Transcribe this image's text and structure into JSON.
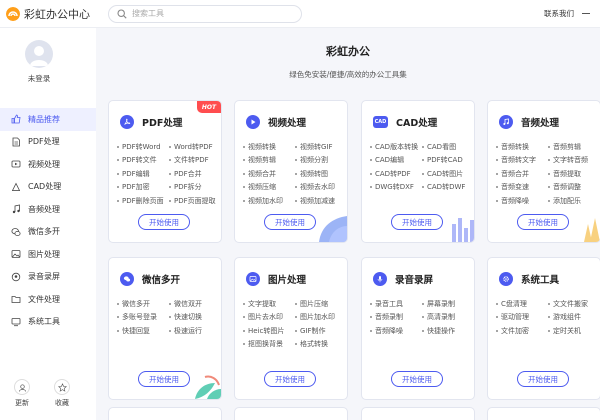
{
  "app": {
    "title": "彩虹办公中心",
    "contact": "联系我们"
  },
  "search": {
    "placeholder": "搜索工具"
  },
  "user": {
    "login": "未登录"
  },
  "sidebar": {
    "items": [
      {
        "label": "精品推荐",
        "icon": "thumbs-up-icon",
        "active": true
      },
      {
        "label": "PDF处理",
        "icon": "pdf-file-icon"
      },
      {
        "label": "视频处理",
        "icon": "video-icon"
      },
      {
        "label": "CAD处理",
        "icon": "cad-icon"
      },
      {
        "label": "音频处理",
        "icon": "music-icon"
      },
      {
        "label": "微信多开",
        "icon": "wechat-icon"
      },
      {
        "label": "图片处理",
        "icon": "image-icon"
      },
      {
        "label": "录音录屏",
        "icon": "record-icon"
      },
      {
        "label": "文件处理",
        "icon": "folder-icon"
      },
      {
        "label": "系统工具",
        "icon": "system-icon"
      }
    ],
    "bottom": [
      {
        "label": "更新",
        "icon": "update-icon"
      },
      {
        "label": "收藏",
        "icon": "star-icon"
      }
    ]
  },
  "main": {
    "title": "彩虹办公",
    "subtitle": "绿色免安装/便捷/高效的办公工具集",
    "start_label": "开始使用",
    "hot_badge": "HOT",
    "cards": [
      {
        "title": "PDF处理",
        "icon": "pdf-icon",
        "hot": true,
        "features": [
          "PDF转Word",
          "Word转PDF",
          "PDF转文件",
          "文件转PDF",
          "PDF编辑",
          "PDF合并",
          "PDF加密",
          "PDF拆分",
          "PDF删除页面",
          "PDF页面提取"
        ]
      },
      {
        "title": "视频处理",
        "icon": "video-play-icon",
        "features": [
          "视频转换",
          "视频转GIF",
          "视频剪辑",
          "视频分割",
          "视频合并",
          "视频转图",
          "视频压缩",
          "视频去水印",
          "视频加水印",
          "视频加减速"
        ]
      },
      {
        "title": "CAD处理",
        "icon": "cad-icon",
        "features": [
          "CAD版本转换",
          "CAD看图",
          "CAD编辑",
          "PDF转CAD",
          "CAD转PDF",
          "CAD转图片",
          "DWG转DXF",
          "CAD转DWF"
        ]
      },
      {
        "title": "音频处理",
        "icon": "music-note-icon",
        "features": [
          "音频转换",
          "音频剪辑",
          "音频转文字",
          "文字转音频",
          "音频合并",
          "音频提取",
          "音频变速",
          "音频调整",
          "音频降噪",
          "添加配乐"
        ]
      },
      {
        "title": "微信多开",
        "icon": "wechat-icon",
        "features": [
          "微信多开",
          "微信双开",
          "多账号登录",
          "快速切换",
          "快捷回复",
          "极速运行"
        ]
      },
      {
        "title": "图片处理",
        "icon": "image-icon",
        "features": [
          "文字提取",
          "图片压缩",
          "图片去水印",
          "图片加水印",
          "Heic转图片",
          "GIF制作",
          "抠图换背景",
          "格式转换"
        ]
      },
      {
        "title": "录音录屏",
        "icon": "microphone-icon",
        "features": [
          "录音工具",
          "屏幕录制",
          "音频录制",
          "高清录制",
          "音频降噪",
          "快捷操作"
        ]
      },
      {
        "title": "系统工具",
        "icon": "gear-icon",
        "features": [
          "C盘清理",
          "文文件搬家",
          "驱动管理",
          "游戏组件",
          "文件加密",
          "定时关机"
        ]
      }
    ]
  },
  "colors": {
    "accent": "#4d5bf0",
    "hot": "#ff4d4f",
    "active_bg": "#eef0ff"
  }
}
